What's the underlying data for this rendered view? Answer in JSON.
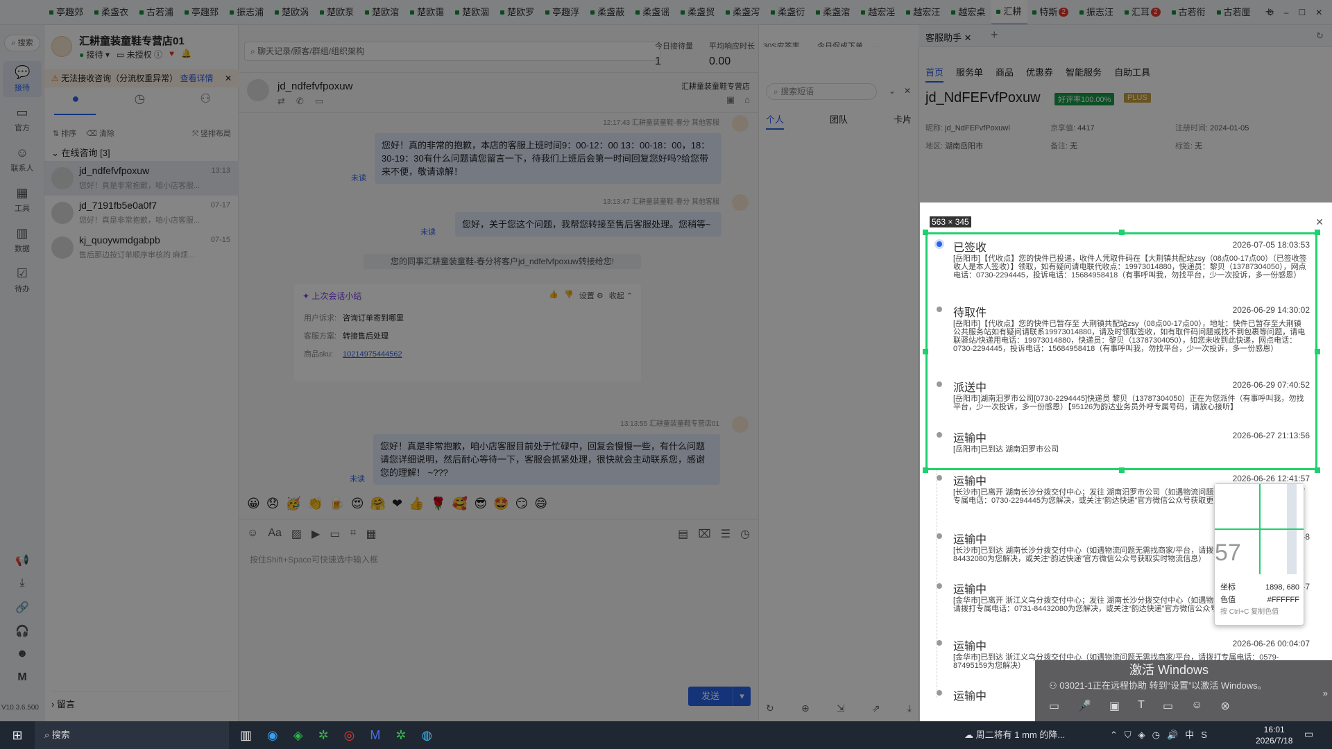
{
  "tabs": [
    {
      "label": "亭趣郊"
    },
    {
      "label": "柔盏衣"
    },
    {
      "label": "古若浦"
    },
    {
      "label": "亭趣郅"
    },
    {
      "label": "振志浦"
    },
    {
      "label": "楚欧涡"
    },
    {
      "label": "楚欧泵"
    },
    {
      "label": "楚欧涫"
    },
    {
      "label": "楚欧霭"
    },
    {
      "label": "楚欧涸"
    },
    {
      "label": "楚欧罗"
    },
    {
      "label": "亭趣浮"
    },
    {
      "label": "柔盏蔽"
    },
    {
      "label": "柔盏谣"
    },
    {
      "label": "柔盏贸"
    },
    {
      "label": "柔盏泻"
    },
    {
      "label": "柔盏衍"
    },
    {
      "label": "柔盏涫"
    },
    {
      "label": "越宏淫"
    },
    {
      "label": "越宏汪"
    },
    {
      "label": "越宏桌"
    },
    {
      "label": "汇耕",
      "active": true
    },
    {
      "label": "特斯",
      "badge": "2"
    },
    {
      "label": "振志汪"
    },
    {
      "label": "汇耳",
      "badge": "2"
    },
    {
      "label": "古若衔"
    },
    {
      "label": "古若厘"
    }
  ],
  "leftnav": {
    "search": "搜索",
    "items": [
      {
        "label": "接待",
        "icon": "chat-icon",
        "active": true
      },
      {
        "label": "官方",
        "icon": "official-icon"
      },
      {
        "label": "联系人",
        "icon": "contacts-icon"
      },
      {
        "label": "工具",
        "icon": "tools-icon"
      },
      {
        "label": "数据",
        "icon": "data-icon"
      },
      {
        "label": "待办",
        "icon": "todo-icon"
      }
    ],
    "version": "V10.3.6.500"
  },
  "store": {
    "name": "汇耕童装童鞋专营店01",
    "status": "接待",
    "auth": "未授权"
  },
  "warning": {
    "text": "无法接收咨询（分流权重异常）",
    "link": "查看详情"
  },
  "conv_toolbar": {
    "sort": "排序",
    "clear": "清除",
    "layout": "竖排布局"
  },
  "online": {
    "label": "在线咨询 [3]"
  },
  "conversations": [
    {
      "name": "jd_ndfefvfpoxuw",
      "time": "13:13",
      "preview": "您好！真是非常抱歉，咱小店客服..."
    },
    {
      "name": "jd_7191fb5e0a0f7",
      "time": "07-17",
      "preview": "您好！真是非常抱歉，咱小店客服..."
    },
    {
      "name": "kj_quoywmdgabpb",
      "time": "07-15",
      "preview": "售后那边按订单顺序审核的 麻烦..."
    }
  ],
  "leave_msg": "留言",
  "search_placeholder": "聊天记录/顾客/群组/组织架构",
  "stats": [
    {
      "label": "今日接待量",
      "value": "1"
    },
    {
      "label": "平均响应时长",
      "value": "0.00"
    },
    {
      "label": "30S应答率",
      "value": "100%"
    },
    {
      "label": "今日促成下单金额",
      "value": "0.00"
    }
  ],
  "chat": {
    "customer": "jd_ndfefvfpoxuw",
    "store_label": "汇耕童装童鞋专营店",
    "msg1_meta": "12:17:43  汇耕童装童鞋-春分  其他客服",
    "msg1": "您好！真的非常的抱歉，本店的客服上班时间9：00-12：00  13：00-18：00，18：30-19：30有什么问题请您留言一下，待我们上班后会第一时间回复您好吗?给您带来不便，敬请谅解！",
    "unread": "未读",
    "msg2_meta": "13:13:47  汇耕童装童鞋-春分  其他客服",
    "msg2": "您好，关于您这个问题，我帮您转接至售后客服处理。您稍等~",
    "transfer": "您的同事汇耕童装童鞋-春分将客户jd_ndfefvfpoxuw转接给您!",
    "summary_title": "上次会话小结",
    "summary_settings": "设置",
    "summary_collapse": "收起",
    "summary_rows": [
      {
        "k": "用户诉求:",
        "v": "咨询订单寄到哪里"
      },
      {
        "k": "客服方案:",
        "v": "转接售后处理"
      },
      {
        "k": "商品sku:",
        "v": "10214975444562",
        "link": true
      }
    ],
    "msg3_meta": "13:13:55  汇耕童装童鞋专营店01",
    "msg3": "您好！真是非常抱歉，咱小店客服目前处于忙碌中，回复会慢慢一些，有什么问题请您详细说明，然后耐心等待一下，客服会抓紧处理，很快就会主动联系您，感谢您的理解！  ~???",
    "input_placeholder": "按住Shift+Space可快速选中输入框",
    "send": "发送"
  },
  "phrases": {
    "search_placeholder": "搜索短语",
    "tabs": [
      "个人",
      "团队",
      "卡片"
    ]
  },
  "assistant": {
    "tab": "客服助手",
    "subtabs": [
      "首页",
      "服务单",
      "商品",
      "优惠券",
      "智能服务",
      "自助工具"
    ],
    "user": "jd_NdFEFvfPoxuw",
    "rating": "好评率100.00%",
    "plus": "PLUS",
    "fields": [
      {
        "k": "昵称:",
        "v": "jd_NdFEFvfPoxuwl"
      },
      {
        "k": "京享值:",
        "v": "4417"
      },
      {
        "k": "注册时间:",
        "v": "2024-01-05"
      },
      {
        "k": "地区:",
        "v": "湖南岳阳市"
      },
      {
        "k": "备注:",
        "v": "无"
      },
      {
        "k": "标签:",
        "v": "无"
      }
    ]
  },
  "selection_size": "563 × 345",
  "tracking": [
    {
      "title": "已签收",
      "time": "2026-07-05 18:03:53",
      "desc": "[岳阳市]【代收点】您的快件已投递，收件人凭取件码在【大荆镇共配站zsy（08点00-17点00）（已签收签收人是本人签收）】领取，如有疑问请电联代收点：19973014880，快递员：黎贝（13787304050），网点电话：0730-2294445，投诉电话：15684958418（有事呼叫我，勿找平台，少一次投诉，多一份感恩）"
    },
    {
      "title": "待取件",
      "time": "2026-06-29 14:30:02",
      "desc": "[岳阳市]【代收点】您的快件已暂存至 大荆镇共配站zsy（08点00-17点00），地址：快件已暂存至大荆镇公共服务站如有疑问请联系19973014880，请及时领取签收，如有取件码问题或找不到包裹等问题，请电联驿站/快递用电话：19973014880，快递员：黎贝（13787304050），如您未收到此快递，网点电话：0730-2294445，投诉电话：15684958418（有事呼叫我，勿找平台，少一次投诉，多一份感恩）"
    },
    {
      "title": "派送中",
      "time": "2026-06-29 07:40:52",
      "desc": "[岳阳市]湖南汨罗市公司[0730-2294445]快递员 黎贝（13787304050）正在为您派件（有事呼叫我，勿找平台，少一次投诉，多一份感恩）【95126为韵达业务员外呼专属号码，请放心接听】"
    },
    {
      "title": "运输中",
      "time": "2026-06-27 21:13:56",
      "desc": "[岳阳市]已到达 湖南汨罗市公司"
    },
    {
      "title": "运输中",
      "time": "2026-06-26 12:41:57",
      "desc": "[长沙市]已离开 湖南长沙分拨交付中心；发往 湖南汨罗市公司（如遇物流问题无需找商家或平台，请拨打专属电话：0730-2294445为您解决，或关注“韵达快递”官方微信公众号获取更多物流信息）"
    },
    {
      "title": "运输中",
      "time": "2026-06-26 03:07:48",
      "desc": "[长沙市]已到达 湖南长沙分拨交付中心（如遇物流问题无需找商家/平台，请拨打专属电话：0731-84432080为您解决，或关注“韵达快递”官方微信公众号获取实时物流信息）"
    },
    {
      "title": "运输中",
      "time": "2026-06-26 01:16:47",
      "desc": "[金华市]已离开 浙江义乌分拨交付中心；发往 湖南长沙分拨交付中心（如遇物流问题无需找商家/平台，请拨打专属电话：0731-84432080为您解决，或关注“韵达快递”官方微信公众号获取实时物流信息）"
    },
    {
      "title": "运输中",
      "time": "2026-06-26 00:04:07",
      "desc": "[金华市]已到达 浙江义乌分拨交付中心（如遇物流问题无需找商家/平台，请拨打专属电话：0579-87495159为您解决）"
    },
    {
      "title": "运输中",
      "time": "",
      "desc": ""
    }
  ],
  "magnifier": {
    "digits": "57",
    "coord_label": "坐标",
    "coord": "1898, 680",
    "color_label": "色值",
    "color": "#FFFFFF",
    "hint": "按 Ctrl+C 复制色值"
  },
  "activation": {
    "title": "激活 Windows",
    "body": "转到“设置”以激活 Windows。",
    "remote": "03021-1正在远程协助"
  },
  "taskbar": {
    "search": "搜索",
    "weather": "周二将有 1 mm 的降...",
    "time": "16:01",
    "date": "2026/7/18",
    "ime": "中"
  },
  "colors": {
    "accent": "#2a62e8",
    "selection": "#1fd16e",
    "send": "#2a62e8"
  }
}
